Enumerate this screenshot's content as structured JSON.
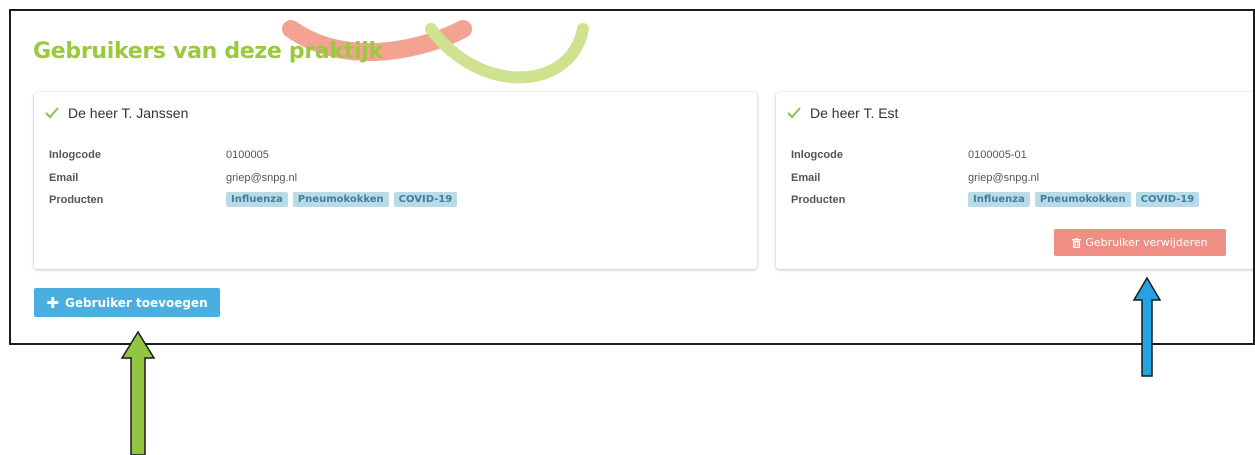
{
  "page": {
    "title": "Gebruikers van deze praktijk"
  },
  "labels": {
    "login": "Inlogcode",
    "email": "Email",
    "products": "Producten"
  },
  "users": [
    {
      "name": "De heer T. Janssen",
      "login": "0100005",
      "email": "griep@snpg.nl",
      "products": [
        "Influenza",
        "Pneumokokken",
        "COVID-19"
      ]
    },
    {
      "name": "De heer T. Est",
      "login": "0100005-01",
      "email": "griep@snpg.nl",
      "products": [
        "Influenza",
        "Pneumokokken",
        "COVID-19"
      ],
      "remove_label": "Gebruiker verwijderen"
    }
  ],
  "actions": {
    "add_label": "Gebruiker toevoegen"
  },
  "colors": {
    "title": "#9bc93d",
    "tag_bg": "#b9dbe8",
    "remove_button": "#ef8f83",
    "add_button": "#4aaee0",
    "arrow_green": "#92c642",
    "arrow_blue": "#24a3e3"
  }
}
